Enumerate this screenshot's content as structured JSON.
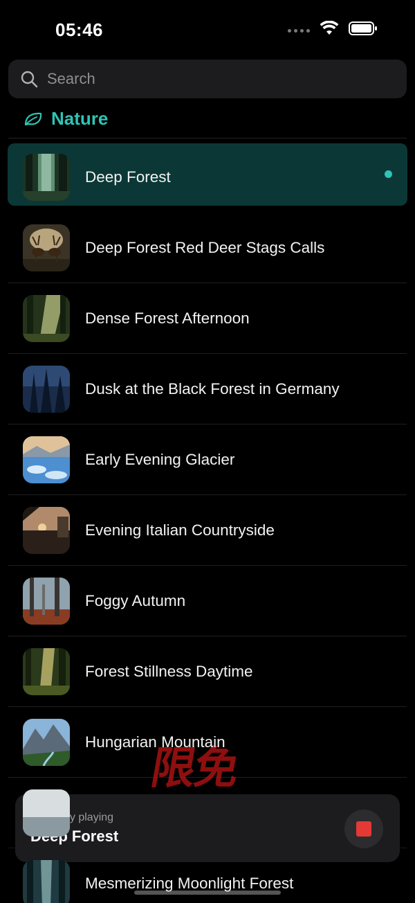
{
  "status_bar": {
    "time": "05:46"
  },
  "search": {
    "placeholder": "Search"
  },
  "category": {
    "label": "Nature",
    "color": "#2ec4b6"
  },
  "tracks": [
    {
      "title": "Deep Forest",
      "selected": true,
      "thumbnail": "deep-forest-thumbnail"
    },
    {
      "title": "Deep Forest Red Deer Stags Calls",
      "selected": false,
      "thumbnail": "red-deer-stags-thumbnail"
    },
    {
      "title": "Dense Forest Afternoon",
      "selected": false,
      "thumbnail": "dense-forest-thumbnail"
    },
    {
      "title": "Dusk at the Black Forest in Germany",
      "selected": false,
      "thumbnail": "black-forest-dusk-thumbnail"
    },
    {
      "title": "Early Evening Glacier",
      "selected": false,
      "thumbnail": "glacier-thumbnail"
    },
    {
      "title": "Evening Italian Countryside",
      "selected": false,
      "thumbnail": "italian-countryside-thumbnail"
    },
    {
      "title": "Foggy Autumn",
      "selected": false,
      "thumbnail": "foggy-autumn-thumbnail"
    },
    {
      "title": "Forest Stillness Daytime",
      "selected": false,
      "thumbnail": "forest-stillness-thumbnail"
    },
    {
      "title": "Hungarian Mountain",
      "selected": false,
      "thumbnail": "hungarian-mountain-thumbnail"
    },
    {
      "title": "",
      "selected": false,
      "thumbnail": "hidden-track-thumbnail"
    },
    {
      "title": "Mesmerizing Moonlight Forest",
      "selected": false,
      "thumbnail": "moonlight-forest-thumbnail"
    }
  ],
  "now_playing": {
    "caption": "Currently playing",
    "title": "Deep Forest",
    "stop_color": "#e53935"
  },
  "watermark": {
    "text": "限免"
  }
}
